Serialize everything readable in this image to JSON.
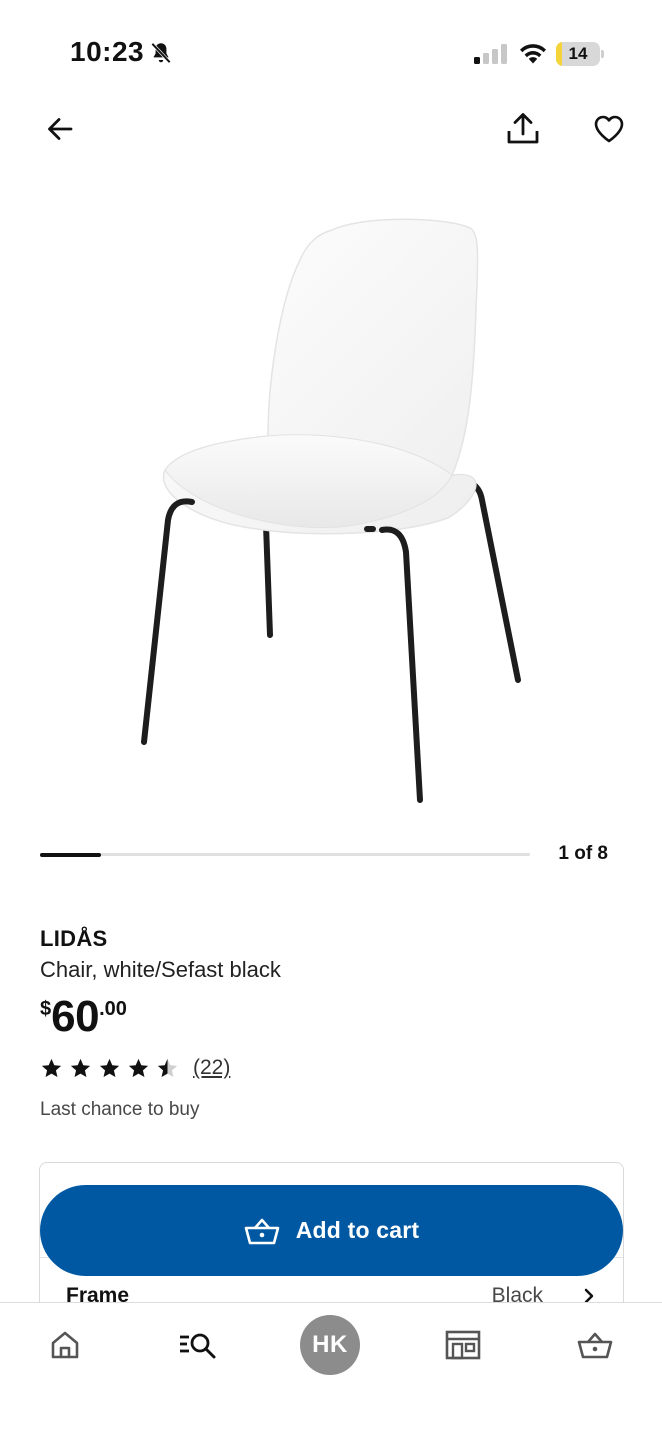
{
  "status_bar": {
    "time": "10:23",
    "battery": "14",
    "battery_fraction": 0.14,
    "battery_color": "#f5d43a",
    "icons": [
      "bell-off-icon",
      "signal-icon",
      "wifi-icon",
      "battery-icon"
    ]
  },
  "nav": {
    "back_icon": "arrow-left-icon",
    "share_icon": "share-icon",
    "favorite_icon": "heart-icon"
  },
  "carousel": {
    "counter": "1 of 8",
    "current": 1,
    "total": 8
  },
  "product": {
    "name": "LIDÅS",
    "description": "Chair, white/Sefast black",
    "price": {
      "currency": "$",
      "integer": "60",
      "decimal": ".00"
    },
    "rating": {
      "value": 4.5,
      "max": 5,
      "review_count": "(22)"
    },
    "availability": "Last chance to buy"
  },
  "options": {
    "label": "Frame",
    "value": "Black"
  },
  "actions": {
    "add_to_cart_label": "Add to cart",
    "add_to_cart_color": "#0058a3"
  },
  "tab_bar": {
    "items": [
      "home-icon",
      "search-icon",
      "profile-avatar",
      "store-icon",
      "cart-icon"
    ],
    "profile_initials": "HK"
  }
}
